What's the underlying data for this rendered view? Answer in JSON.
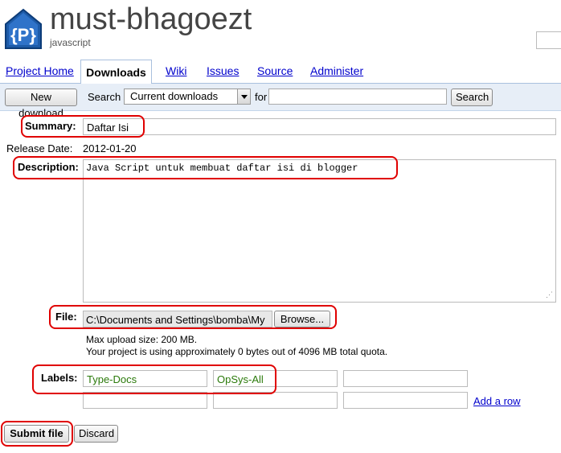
{
  "header": {
    "project_name": "must-bhagoezt",
    "project_summary": "javascript",
    "logo_letter": "{P}"
  },
  "tabs": [
    {
      "label": "Project Home"
    },
    {
      "label": "Downloads"
    },
    {
      "label": "Wiki"
    },
    {
      "label": "Issues"
    },
    {
      "label": "Source"
    },
    {
      "label": "Administer"
    }
  ],
  "toolbar": {
    "new_download_label": "New download",
    "search_label": "Search",
    "select_value": "Current downloads",
    "for_label": "for",
    "query_value": "",
    "search_button_label": "Search"
  },
  "form": {
    "summary_label": "Summary:",
    "summary_value": "Daftar Isi",
    "release_date_label": "Release Date:",
    "release_date_value": "2012-01-20",
    "description_label": "Description:",
    "description_value": "Java Script untuk membuat daftar isi di blogger",
    "file_label": "File:",
    "file_value": "C:\\Documents and Settings\\bomba\\My",
    "browse_label": "Browse...",
    "max_upload": "Max upload size: 200 MB.",
    "quota": "Your project is using approximately 0 bytes out of 4096 MB total quota.",
    "labels_label": "Labels:",
    "labels": [
      "Type-Docs",
      "OpSys-All",
      "",
      "",
      "",
      "",
      ""
    ],
    "add_row_label": "Add a row",
    "submit_label": "Submit file",
    "discard_label": "Discard"
  },
  "colors": {
    "highlight": "#e00000",
    "toolbar_bg": "#e7eef7",
    "link": "#0000cc",
    "label_text": "#2b7a0b"
  }
}
